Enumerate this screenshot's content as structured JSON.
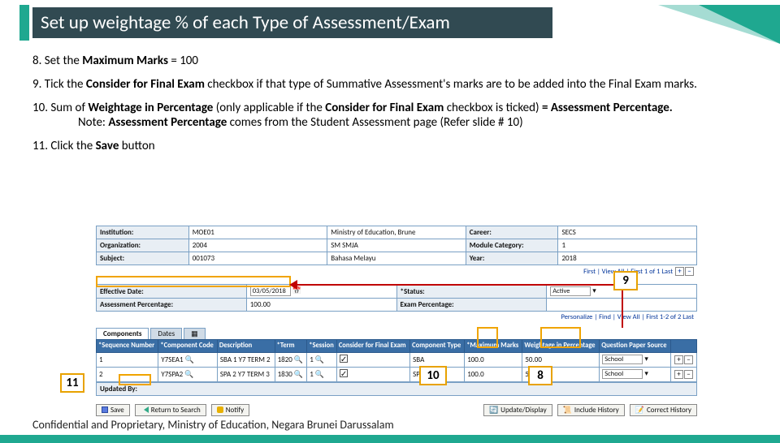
{
  "title": "Set up weightage % of each Type of Assessment/Exam",
  "steps": {
    "s8_pre": "8. Set the ",
    "s8_b": "Maximum Marks",
    "s8_post": " = 100",
    "s9_pre": "9. Tick the ",
    "s9_b": "Consider for Final Exam ",
    "s9_post": "checkbox if that type of Summative Assessment's marks are to be added into the Final Exam marks.",
    "s10_pre": "10. Sum of ",
    "s10_b1": "Weightage in Percentage ",
    "s10_mid": "(only applicable if the ",
    "s10_b2": "Consider for Final Exam ",
    "s10_mid2": "checkbox is ticked)",
    "s10_b3": " = Assessment Percentage.",
    "s10_note_pre": "Note: ",
    "s10_note_b": "Assessment Percentage ",
    "s10_note_post": "comes from the Student Assessment page (Refer slide # 10)",
    "s11_pre": "11. Click the ",
    "s11_b": "Save ",
    "s11_post": "button"
  },
  "info": {
    "inst_l": "Institution:",
    "inst_v": "MOE01",
    "inst_desc": "Ministry of Education, Brune",
    "car_l": "Career:",
    "car_v": "SECS",
    "org_l": "Organization:",
    "org_v": "2004",
    "org_desc": "SM SMJA",
    "mod_l": "Module Category:",
    "mod_v": "1",
    "sub_l": "Subject:",
    "sub_v": "001073",
    "sub_desc": "Bahasa Melayu",
    "yr_l": "Year:",
    "yr_v": "2018"
  },
  "mid": {
    "eff_l": "Effective Date:",
    "eff_v": "03/05/2018",
    "stat_l": "*Status:",
    "stat_v": "Active",
    "ap_l": "Assessment Percentage:",
    "ap_v": "100.00",
    "ep_l": "Exam Percentage:",
    "nav1": "First  |  View All  |  First 1 of 1  Last",
    "nav2": "Personalize | Find | View All |  First 1-2 of 2  Last"
  },
  "tabs": {
    "t1": "Components",
    "t2": "Dates",
    "t3": "▦"
  },
  "grid": {
    "h1": "*Sequence Number",
    "h2": "*Component Code",
    "h3": "Description",
    "h4": "*Term",
    "h5": "*Session",
    "h6": "Consider for Final Exam",
    "h7": "Component Type",
    "h8": "*Maximum Marks",
    "h9": "Weightage in Percentage",
    "h10": "Question Paper Source",
    "r": [
      {
        "seq": "1",
        "code": "Y7SEA1",
        "desc": "SBA 1 Y7 TERM 2",
        "term": "1820",
        "sess": "1",
        "chk": true,
        "ctype": "SBA",
        "max": "100.0",
        "wt": "50.00",
        "src": "School"
      },
      {
        "seq": "2",
        "code": "Y7SPA2",
        "desc": "SPA 2 Y7 TERM 3",
        "term": "1830",
        "sess": "1",
        "chk": true,
        "ctype": "SPA",
        "max": "100.0",
        "wt": "50.00",
        "src": "School"
      }
    ]
  },
  "upd": "Updated By:",
  "btns": {
    "save": "Save",
    "ret": "Return to Search",
    "not": "Notify",
    "upd2": "Update/Display",
    "inc": "Include History",
    "cor": "Correct History"
  },
  "callouts": {
    "c8": "8",
    "c9": "9",
    "c10": "10",
    "c11": "11"
  },
  "footer": "Confidential and Proprietary, Ministry of Education, Negara Brunei Darussalam"
}
